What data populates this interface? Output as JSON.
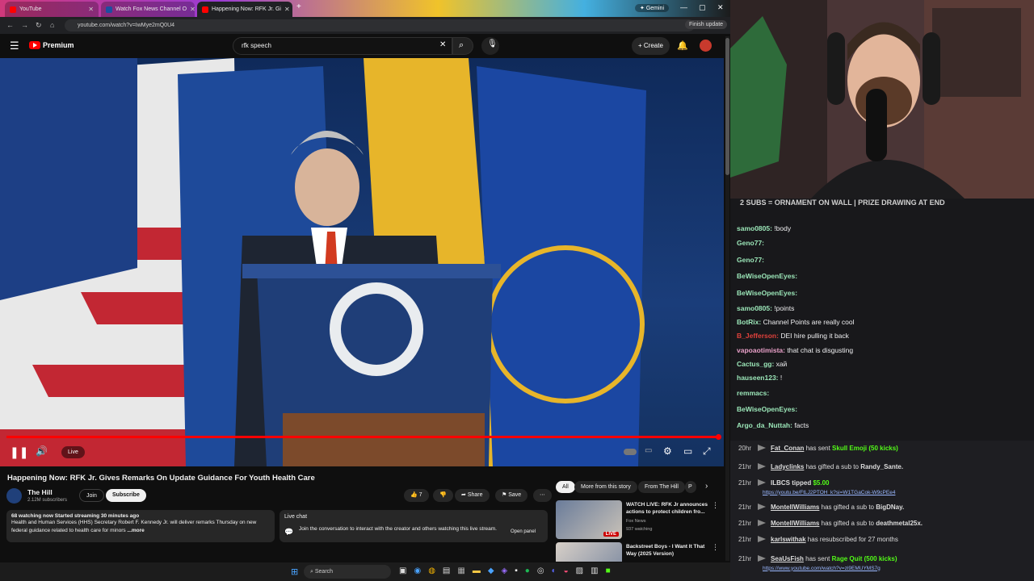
{
  "browser": {
    "tabs": [
      {
        "label": "YouTube",
        "active": false
      },
      {
        "label": "Watch Fox News Channel O",
        "active": false
      },
      {
        "label": "Happening Now: RFK Jr. Gi",
        "active": true
      }
    ],
    "gemini_label": "Gemini",
    "url": "youtube.com/watch?v=IwMye2mQ0U4",
    "finish_update": "Finish update"
  },
  "youtube": {
    "logo": "Premium",
    "search_value": "rfk speech",
    "create_label": "Create",
    "video": {
      "live_label": "Live",
      "progress": 1.0
    },
    "title": "Happening Now: RFK Jr. Gives Remarks On Update Guidance For Youth Health Care",
    "channel": {
      "name": "The Hill",
      "subs": "2.12M subscribers",
      "join": "Join",
      "subscribe": "Subscribe"
    },
    "actions": {
      "likes": "7",
      "share": "Share",
      "save": "Save"
    },
    "description": {
      "stats": "68 watching now  Started streaming 30 minutes ago",
      "text": "Health and Human Services (HHS) Secretary Robert F. Kennedy Jr. will deliver remarks Thursday on new federal guidance related to health care for minors",
      "more": "...more"
    },
    "live_chat": {
      "title": "Live chat",
      "text": "Join the conversation to interact with the creator and others watching this live stream.",
      "open": "Open panel"
    },
    "filter_chips": [
      "All",
      "More from this story",
      "From The Hill",
      "P"
    ],
    "recommendations": [
      {
        "title": "WATCH LIVE: RFK Jr announces actions to protect children fro...",
        "channel": "Fox News",
        "meta": "937 watching",
        "badge": "LIVE"
      },
      {
        "title": "Backstreet Boys - I Want It That Way (2025 Version)",
        "channel": "",
        "meta": "",
        "badge": ""
      }
    ]
  },
  "stream": {
    "banner": "2 SUBS = ORNAMENT ON WALL | PRIZE DRAWING AT END",
    "chat": [
      {
        "user": "samo0805",
        "msg": "!body",
        "color": "#9be6b8"
      },
      {
        "user": "Geno77",
        "msg": "",
        "color": "#9be6b8"
      },
      {
        "user": "Geno77",
        "msg": "",
        "color": "#9be6b8"
      },
      {
        "user": "BeWiseOpenEyes",
        "msg": "",
        "color": "#9be6b8"
      },
      {
        "user": "BeWiseOpenEyes",
        "msg": "",
        "color": "#9be6b8"
      },
      {
        "user": "samo0805",
        "msg": "!points",
        "color": "#9be6b8"
      },
      {
        "user": "BotRix",
        "msg": "Channel Points are really cool",
        "color": "#9be6b8"
      },
      {
        "user": "B_Jefferson",
        "msg": "DEI hire pulling it back",
        "color": "#e0413b"
      },
      {
        "user": "vapoaotimista",
        "msg": "that chat is disgusting",
        "color": "#e8a0c8"
      },
      {
        "user": "Cactus_gg",
        "msg": "хай",
        "color": "#9be6b8"
      },
      {
        "user": "hauseen123",
        "msg": "!",
        "color": "#9be6b8"
      },
      {
        "user": "remmacs",
        "msg": "",
        "color": "#9be6b8"
      },
      {
        "user": "BeWiseOpenEyes",
        "msg": "",
        "color": "#9be6b8"
      },
      {
        "user": "Argo_da_Nuttah",
        "msg": "facts",
        "color": "#9be6b8"
      }
    ],
    "events": [
      {
        "time": "20hr",
        "text1": "Fat_Conan",
        "text2": " has sent ",
        "text3": "Skull Emoji (50 kicks)",
        "link": ""
      },
      {
        "time": "21hr",
        "text1": "Ladyclinks",
        "text2": " has gifted a sub to ",
        "text3": "Randy_Sante.",
        "link": ""
      },
      {
        "time": "21hr",
        "text1": "ILBCS tipped ",
        "text2": "$5.00",
        "text3": "",
        "link": "https://youtu.be/FtLJ2PTOH_k?si=W1TGaCok-W9cPEe4"
      },
      {
        "time": "21hr",
        "text1": "MontellWilliams",
        "text2": " has gifted a sub to ",
        "text3": "BigDNay.",
        "link": ""
      },
      {
        "time": "21hr",
        "text1": "MontellWilliams",
        "text2": " has gifted a sub to ",
        "text3": "deathmetal25x.",
        "link": ""
      },
      {
        "time": "21hr",
        "text1": "karlswithak",
        "text2": " has resubscribed for 27 months",
        "text3": "",
        "link": ""
      },
      {
        "time": "21hr",
        "text1": "SeaUsFish",
        "text2": " has sent ",
        "text3": "Rage Quit (500 kicks)",
        "link": "https://www.youtube.com/watch?v=zi9EMUYMS7g"
      }
    ]
  },
  "taskbar": {
    "search": "Search"
  }
}
